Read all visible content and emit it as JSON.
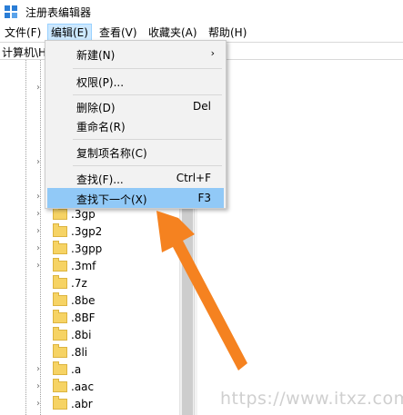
{
  "window": {
    "title": "注册表编辑器"
  },
  "menubar": {
    "file": "文件(F)",
    "edit": "编辑(E)",
    "view": "查看(V)",
    "favorites": "收藏夹(A)",
    "help": "帮助(H)"
  },
  "address": {
    "path": "计算机\\H"
  },
  "edit_menu": {
    "new": "新建(N)",
    "new_arrow": "›",
    "permissions": "权限(P)...",
    "delete": "删除(D)",
    "delete_key": "Del",
    "rename": "重命名(R)",
    "copy_key_name": "复制项名称(C)",
    "find": "查找(F)...",
    "find_key": "Ctrl+F",
    "find_next": "查找下一个(X)",
    "find_next_key": "F3"
  },
  "tree": {
    "items": [
      ".3gp",
      ".3gp2",
      ".3gpp",
      ".3mf",
      ".7z",
      ".8be",
      ".8BF",
      ".8bi",
      ".8li",
      ".a",
      ".aac",
      ".abr"
    ]
  },
  "watermark": "https://www.itxz.com",
  "colors": {
    "highlight": "#91c9f7",
    "arrow": "#f58220",
    "active_menu": "#cce8ff"
  }
}
